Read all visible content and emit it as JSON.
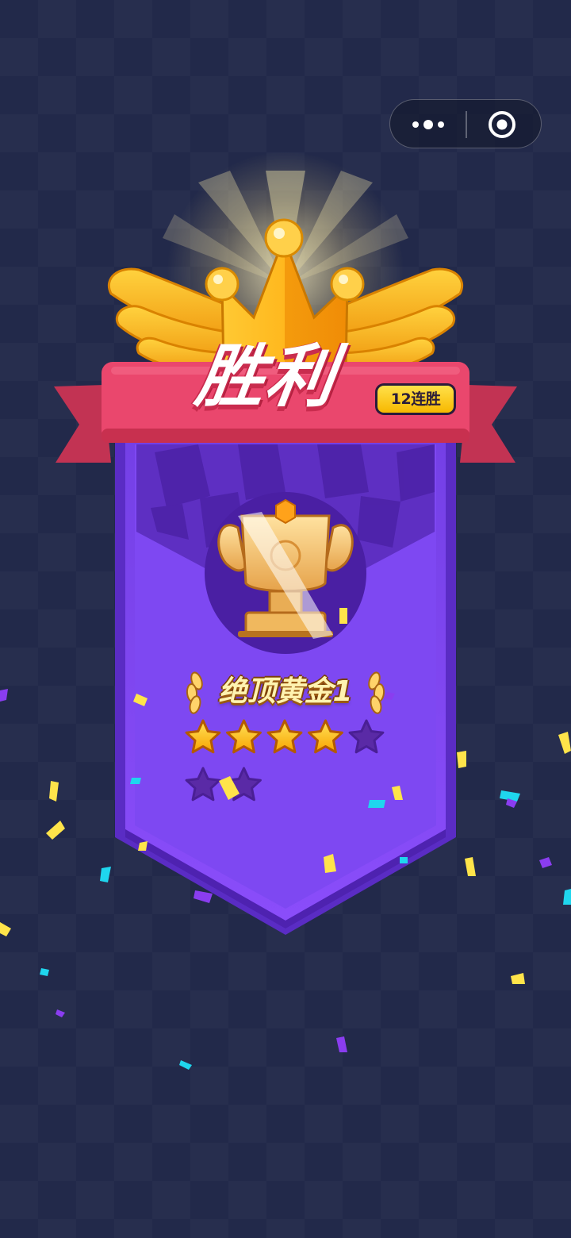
{
  "result": {
    "title": "胜利",
    "streak_badge": "12连胜"
  },
  "rank": {
    "name": "绝顶黄金1",
    "stars_earned": 4,
    "stars_row1_total": 5,
    "stars_row2_total": 2
  },
  "capsule": {
    "more_icon": "more-dots-icon",
    "close_icon": "target-close-icon"
  },
  "colors": {
    "background": "#22294a",
    "ribbon": "#e8456a",
    "banner": "#7b47f0",
    "gold": "#f7b500",
    "star_empty": "#5a2aa6"
  }
}
